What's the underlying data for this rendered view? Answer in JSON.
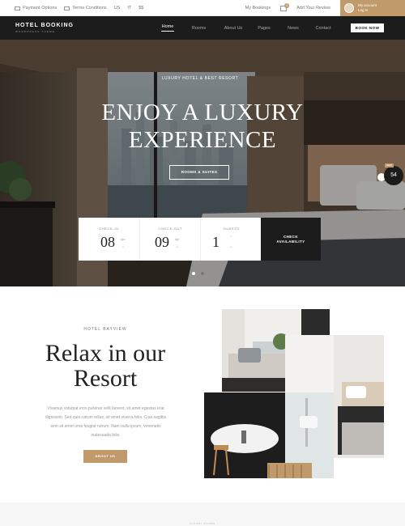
{
  "topbar": {
    "payment_label": "Payment Options",
    "terms_label": "Terms Conditions",
    "currency": "US",
    "lang": "IT",
    "extra": "$$",
    "bookings_label": "My Bookings",
    "cart_count": "0",
    "review_label": "Add Your Review",
    "account_line1": "My account",
    "account_line2": "Log in"
  },
  "nav": {
    "logo_main": "HOTEL BOOKING",
    "logo_sub": "WORDPRESS THEME",
    "items": [
      "Home",
      "Rooms",
      "About Us",
      "Pages",
      "News",
      "Contact"
    ],
    "active_item": "Home",
    "book_now": "BOOK NOW"
  },
  "hero": {
    "tagline": "LUXURY HOTEL & BEST RESORT",
    "title_line1": "ENJOY A LUXURY",
    "title_line2": "EXPERIENCE",
    "button": "ROOMS & SUITES",
    "badge_value": "54",
    "badge_tag": "NEW",
    "slides": 2,
    "active_slide": 1
  },
  "booking": {
    "checkin_label": "CHECK-IN",
    "checkin_day": "08",
    "checkin_month": "Apr",
    "checkout_label": "CHECK-OUT",
    "checkout_day": "09",
    "checkout_month": "Apr",
    "guests_label": "GUESTS",
    "guests_value": "1",
    "check_line1": "CHECK",
    "check_line2": "AVAILABILITY"
  },
  "about": {
    "eyebrow": "HOTEL BAYVIEW",
    "title_line1": "Relax in our",
    "title_line2": "Resort",
    "text_line1": "Vivamus volutpat eros pulvinar velit laoreet, sit amet egestas erat",
    "text_line2": "dignissim. Sed quis rutrum tellus, sit amet viverra felis. Cras sagittis",
    "text_line3": "sem sit amet urna feugiat rutrum. Nam nulla ipsum, venenatis",
    "text_line4": "malesuada felis.",
    "button": "ABOUT US"
  },
  "footer": {
    "eyebrow": "LUXURY ROOMS"
  },
  "colors": {
    "accent": "#c19a6b",
    "dark": "#1c1c1c"
  }
}
